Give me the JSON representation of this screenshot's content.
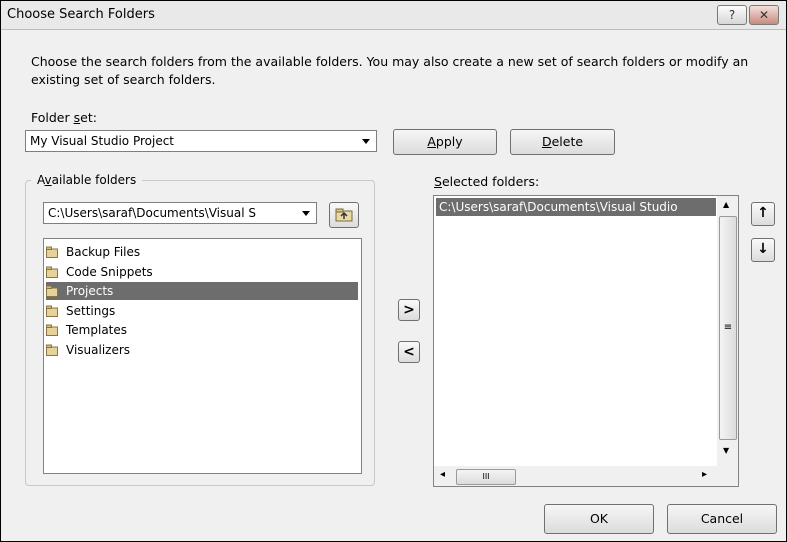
{
  "dialog": {
    "title": "Choose Search Folders",
    "help_label": "?",
    "close_label": "✕"
  },
  "description": "Choose the search folders from the available folders. You may also create a new set of search folders or modify an existing set of search folders.",
  "folder_set": {
    "label_pre": "Folder ",
    "label_key": "s",
    "label_post": "et:",
    "value": "My Visual Studio Project"
  },
  "apply": {
    "key": "A",
    "rest": "pply"
  },
  "delete": {
    "key": "D",
    "rest": "elete"
  },
  "available": {
    "label_pre": "A",
    "label_key": "v",
    "label_post": "ailable folders",
    "path": "C:\\Users\\saraf\\Documents\\Visual S",
    "items": [
      "Backup Files",
      "Code Snippets",
      "Projects",
      "Settings",
      "Templates",
      "Visualizers"
    ],
    "selected_index": 2
  },
  "selected": {
    "label_key": "S",
    "label_post": "elected folders:",
    "items": [
      "C:\\Users\\saraf\\Documents\\Visual Studio"
    ]
  },
  "move": {
    "add": ">",
    "remove": "<"
  },
  "reorder": {
    "up": "↑",
    "down": "↓"
  },
  "scroll_glyphs": {
    "up": "▲",
    "down": "▼",
    "left": "◂",
    "right": "▸",
    "thumb_h": "III",
    "thumb_v": "≡"
  },
  "ok_label": "OK",
  "cancel_label": "Cancel"
}
